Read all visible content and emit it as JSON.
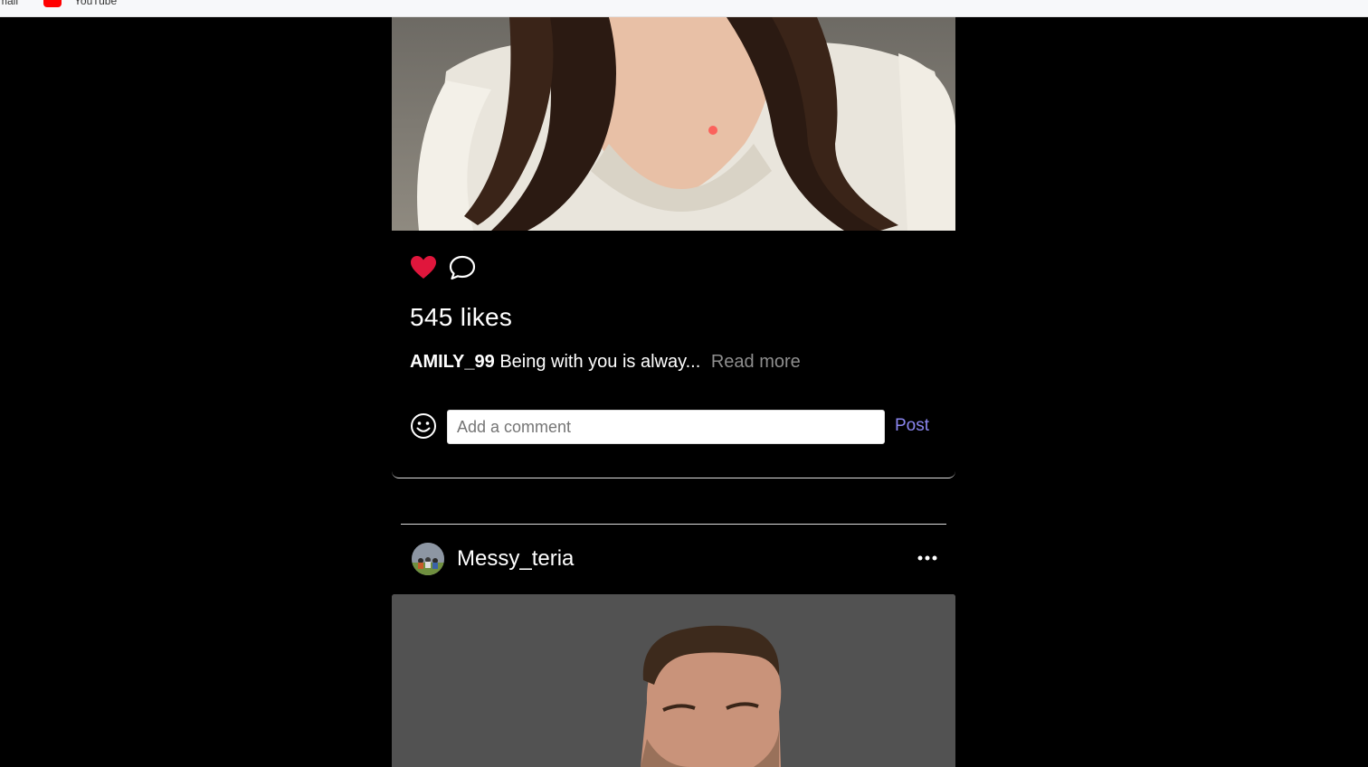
{
  "bookmarks": {
    "mail_label": "mail",
    "youtube_label": "YouTube"
  },
  "post1": {
    "likes_text": "545 likes",
    "caption_user": "AMILY_99",
    "caption_text": "Being with you is alway...",
    "read_more": "Read more",
    "comment_placeholder": "Add a comment",
    "post_label": "Post"
  },
  "post2": {
    "username": "Messy_teria"
  },
  "colors": {
    "like_red": "#e0163c",
    "post_link": "#8b86f0",
    "background": "#000000"
  },
  "icons": {
    "like": "heart-icon",
    "comment": "speech-bubble-icon",
    "emoji": "smiley-icon",
    "more": "three-dots-icon"
  }
}
